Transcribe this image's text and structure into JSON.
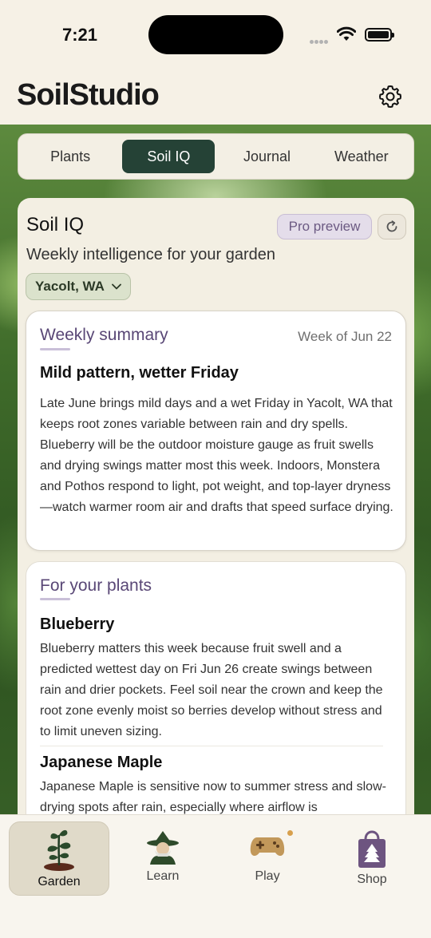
{
  "status_bar": {
    "time": "7:21"
  },
  "app": {
    "logo": "SoilStudio"
  },
  "tabs": [
    {
      "label": "Plants",
      "active": false
    },
    {
      "label": "Soil IQ",
      "active": true
    },
    {
      "label": "Journal",
      "active": false
    },
    {
      "label": "Weather",
      "active": false
    }
  ],
  "soil_iq": {
    "title": "Soil IQ",
    "badge": "Pro preview",
    "subtitle": "Weekly intelligence for your garden",
    "location": "Yacolt, WA"
  },
  "weekly_summary": {
    "section_title": "Weekly summary",
    "week": "Week of Jun 22",
    "headline": "Mild pattern, wetter Friday",
    "body": "Late June brings mild days and a wet Friday in Yacolt, WA that keeps root zones variable between rain and dry spells. Blueberry will be the outdoor moisture gauge as fruit swells and drying swings matter most this week. Indoors, Monstera and Pothos respond to light, pot weight, and top-layer dryness—watch warmer room air and drafts that speed surface drying."
  },
  "for_your_plants": {
    "section_title": "For your plants",
    "items": [
      {
        "name": "Blueberry",
        "text": "Blueberry matters this week because fruit swell and a predicted wettest day on Fri Jun 26 create swings between rain and drier pockets. Feel soil near the crown and keep the root zone evenly moist so berries develop without stress and to limit uneven sizing."
      },
      {
        "name": "Japanese Maple",
        "text": "Japanese Maple is sensitive now to summer stress and slow-drying spots after rain, especially where airflow is"
      }
    ]
  },
  "bottom_nav": [
    {
      "label": "Garden",
      "icon": "sprout-icon",
      "active": true
    },
    {
      "label": "Learn",
      "icon": "wizard-icon",
      "active": false
    },
    {
      "label": "Play",
      "icon": "gamepad-icon",
      "active": false
    },
    {
      "label": "Shop",
      "icon": "shopping-bag-icon",
      "active": false
    }
  ],
  "colors": {
    "accent_dark_green": "#254236",
    "section_purple": "#594776",
    "badge_bg": "#e4ddea",
    "location_bg": "#dbe2cc",
    "notification_dot": "#d8a04d"
  }
}
